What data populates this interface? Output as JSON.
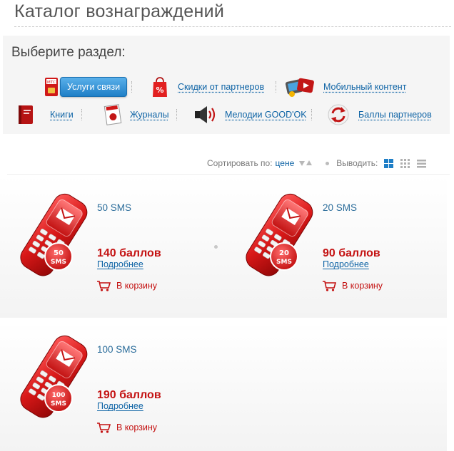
{
  "page": {
    "title": "Каталог вознаграждений"
  },
  "sections": {
    "heading": "Выберите раздел:",
    "items": [
      {
        "label": "Услуги связи",
        "icon": "mts-sim-icon",
        "active": true
      },
      {
        "label": "Скидки от партнеров",
        "icon": "discount-bag-icon"
      },
      {
        "label": "Мобильный контент",
        "icon": "mobile-content-icon"
      },
      {
        "label": "Книги",
        "icon": "book-icon"
      },
      {
        "label": "Журналы",
        "icon": "magazine-icon"
      },
      {
        "label": "Мелодии GOOD'OK",
        "icon": "speaker-icon"
      },
      {
        "label": "Баллы партнеров",
        "icon": "exchange-arrows-icon"
      }
    ]
  },
  "sort": {
    "label": "Сортировать по:",
    "field": "цене",
    "output_label": "Выводить:"
  },
  "products": [
    {
      "name": "50 SMS",
      "badge_top": "50",
      "badge_bottom": "SMS",
      "price": "140 баллов",
      "more": "Подробнее",
      "cart": "В корзину"
    },
    {
      "name": "20 SMS",
      "badge_top": "20",
      "badge_bottom": "SMS",
      "price": "90 баллов",
      "more": "Подробнее",
      "cart": "В корзину"
    },
    {
      "name": "100 SMS",
      "badge_top": "100",
      "badge_bottom": "SMS",
      "price": "190 баллов",
      "more": "Подробнее",
      "cart": "В корзину"
    }
  ],
  "colors": {
    "accent_red": "#c41212",
    "link_blue": "#0d63a5",
    "button_blue": "#1f7fc7"
  }
}
